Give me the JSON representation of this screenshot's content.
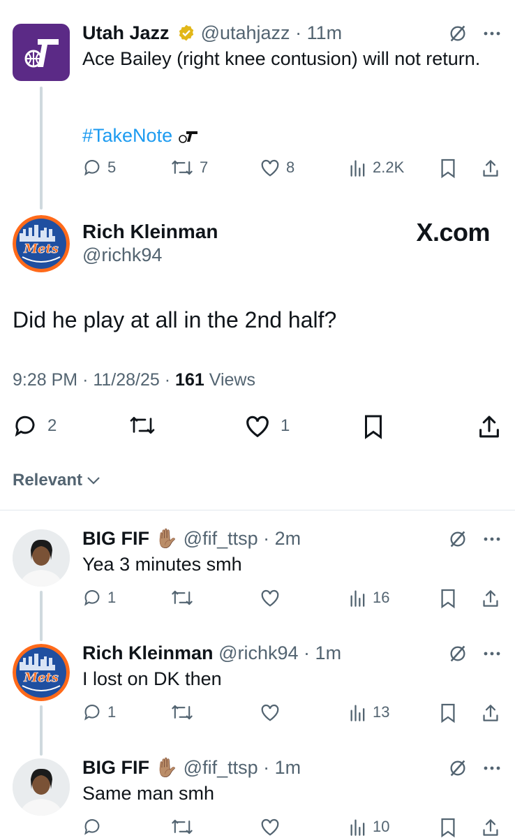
{
  "tweet1": {
    "name": "Utah Jazz",
    "handle": "@utahjazz",
    "sep": "·",
    "time": "11m",
    "text": "Ace Bailey (right knee contusion) will not return.",
    "hashtag": "#TakeNote",
    "replies": "5",
    "retweets": "7",
    "likes": "8",
    "views": "2.2K"
  },
  "main": {
    "name": "Rich Kleinman",
    "handle": "@richk94",
    "brand": "X.com",
    "text": "Did he play at all in the 2nd half?",
    "time": "9:28 PM",
    "sep": "·",
    "date": "11/28/25",
    "views_count": "161",
    "views_label": "Views",
    "replies": "2",
    "likes": "1"
  },
  "sort": {
    "label": "Relevant"
  },
  "replies": [
    {
      "name": "BIG FIF",
      "emoji": "✋🏽",
      "handle": "@fif_ttsp",
      "sep": "·",
      "time": "2m",
      "text": "Yea 3 minutes smh",
      "replies": "1",
      "views": "16"
    },
    {
      "name": "Rich Kleinman",
      "emoji": "",
      "handle": "@richk94",
      "sep": "·",
      "time": "1m",
      "text": "I lost on DK then",
      "replies": "1",
      "views": "13"
    },
    {
      "name": "BIG FIF",
      "emoji": "✋🏽",
      "handle": "@fif_ttsp",
      "sep": "·",
      "time": "1m",
      "text": "Same man smh",
      "replies": "",
      "views": "10"
    }
  ],
  "colors": {
    "jazz_purple": "#5b2a86",
    "mets_blue": "#1f4fa0",
    "mets_orange": "#ff6a1a",
    "link": "#1d9bf0",
    "muted": "#536471"
  }
}
